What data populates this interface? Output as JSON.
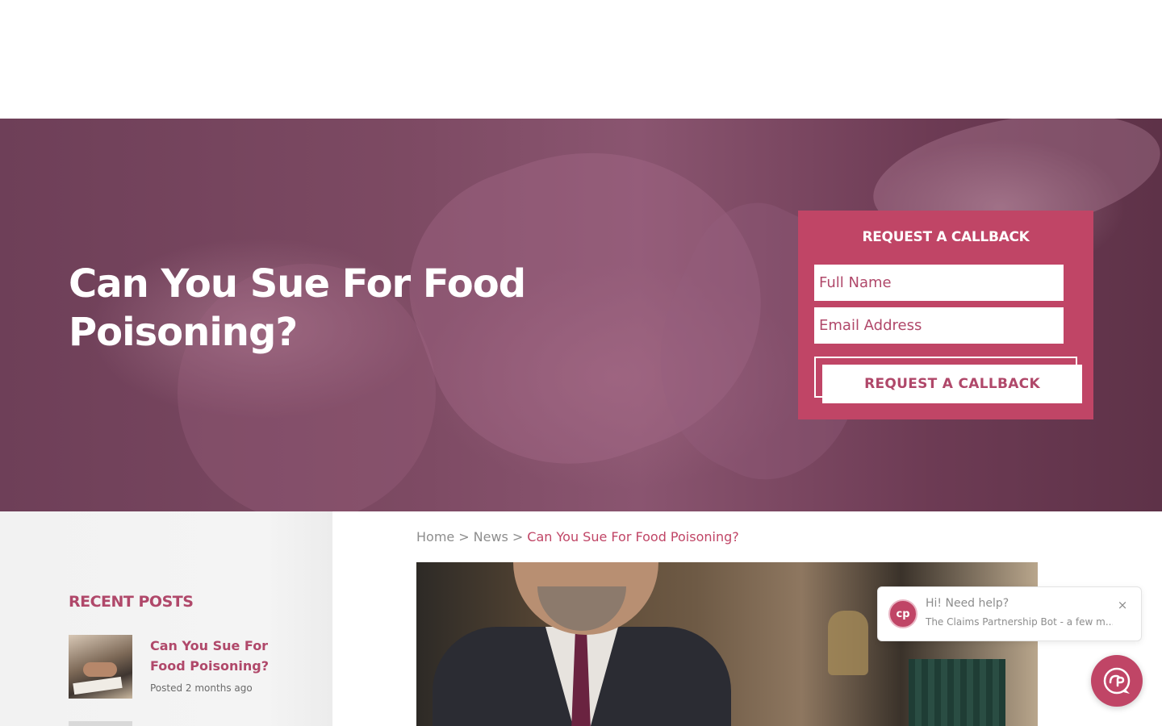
{
  "hero": {
    "title": "Can You Sue For Food Poisoning?"
  },
  "callback_form": {
    "heading": "REQUEST A CALLBACK",
    "full_name_placeholder": "Full Name",
    "email_placeholder": "Email Address",
    "submit_label": "REQUEST A CALLBACK"
  },
  "breadcrumb": {
    "items": [
      "Home",
      "News",
      "Can You Sue For Food Poisoning?"
    ],
    "separator": ">"
  },
  "sidebar": {
    "recent_posts_title": "RECENT POSTS",
    "posts": [
      {
        "title": "Can You Sue For Food Poisoning?",
        "meta": "Posted 2 months ago"
      }
    ]
  },
  "chat": {
    "greeting": "Hi! Need help?",
    "subtitle": "The Claims Partnership Bot - a few m...",
    "close_label": "×",
    "avatar_text": "cp",
    "launcher_icon": "chat-icon"
  },
  "colors": {
    "brand": "#c04566",
    "hero_overlay": "#7d4a63",
    "sidebar_bg": "#f2f2f2"
  }
}
